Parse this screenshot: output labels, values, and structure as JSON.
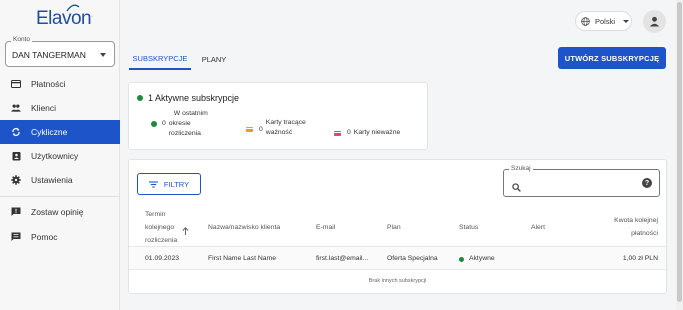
{
  "brand": {
    "logo_text": "Elavon",
    "logo_tm": "."
  },
  "account": {
    "label": "Konto",
    "value": "DAN TANGERMAN"
  },
  "sidebar": {
    "items": [
      {
        "label": "Płatności",
        "icon": "credit-card-icon"
      },
      {
        "label": "Klienci",
        "icon": "people-icon"
      },
      {
        "label": "Cykliczne",
        "icon": "sync-icon",
        "active": true
      },
      {
        "label": "Użytkownicy",
        "icon": "badge-icon"
      },
      {
        "label": "Ustawienia",
        "icon": "gear-icon"
      }
    ],
    "secondary": [
      {
        "label": "Zostaw opinię",
        "icon": "feedback-icon"
      },
      {
        "label": "Pomoc",
        "icon": "help-icon"
      }
    ]
  },
  "header": {
    "language": "Polski"
  },
  "tabs": [
    {
      "label": "SUBSKRYPCJE",
      "active": true
    },
    {
      "label": "PLANY",
      "active": false
    }
  ],
  "create_button": "UTWÓRZ SUBSKRYPCJĘ",
  "summary": {
    "title": "1 Aktywne subskrypcje",
    "stats": [
      {
        "count": "0",
        "label_lines": [
          "W ostatnim",
          "okresie",
          "rozliczenia"
        ],
        "color": "#1e8a3a"
      },
      {
        "count": "0",
        "label_lines": [
          "Karty tracące",
          "ważność"
        ],
        "color": "#e89a2c"
      },
      {
        "count": "0",
        "label_lines": [
          "Karty nieważne"
        ],
        "color": "#e0446a"
      }
    ]
  },
  "table": {
    "filter_label": "FILTRY",
    "search_label": "Szukaj",
    "columns": {
      "due": [
        "Termin",
        "kolejnego",
        "rozliczenia"
      ],
      "name": "Nazwa/nazwisko klienta",
      "email": "E-mail",
      "plan": "Plan",
      "status": "Status",
      "alert": "Alert",
      "amount": [
        "Kwota kolejnej",
        "płatności"
      ]
    },
    "rows": [
      {
        "due": "01.09.2023",
        "name": "First Name Last Name",
        "email": "first.last@email...",
        "plan": "Oferta Specjalna",
        "status": "Aktywne",
        "alert": "",
        "amount": "1,00 zł PLN"
      }
    ],
    "empty_text": "Brak innych subskrypcji"
  },
  "colors": {
    "accent": "#1e54c9",
    "active_status": "#1e8a3a"
  }
}
